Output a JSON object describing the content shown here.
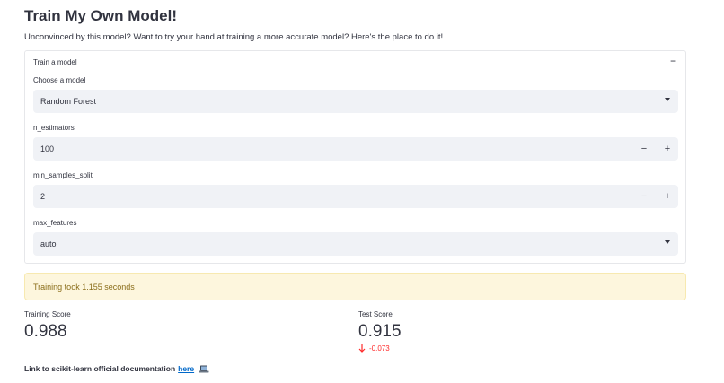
{
  "page": {
    "title": "Train My Own Model!",
    "subtitle": "Unconvinced by this model? Want to try your hand at training a more accurate model? Here's the place to do it!"
  },
  "expander": {
    "header": "Train a model",
    "collapse_symbol": "−",
    "fields": {
      "model": {
        "label": "Choose a model",
        "value": "Random Forest"
      },
      "n_estimators": {
        "label": "n_estimators",
        "value": "100"
      },
      "min_samples_split": {
        "label": "min_samples_split",
        "value": "2"
      },
      "max_features": {
        "label": "max_features",
        "value": "auto"
      }
    },
    "stepper": {
      "minus": "−",
      "plus": "+"
    }
  },
  "alert": {
    "text": "Training took 1.155 seconds"
  },
  "metrics": {
    "training": {
      "label": "Training Score",
      "value": "0.988"
    },
    "test": {
      "label": "Test Score",
      "value": "0.915",
      "delta": "-0.073"
    }
  },
  "footer": {
    "prefix": "Link to scikit-learn official documentation",
    "link_text": "here"
  },
  "colors": {
    "accent_link": "#0068c9",
    "delta_negative": "#ff2b2b",
    "alert_bg": "#fdf6dd",
    "input_bg": "#f0f2f6"
  }
}
